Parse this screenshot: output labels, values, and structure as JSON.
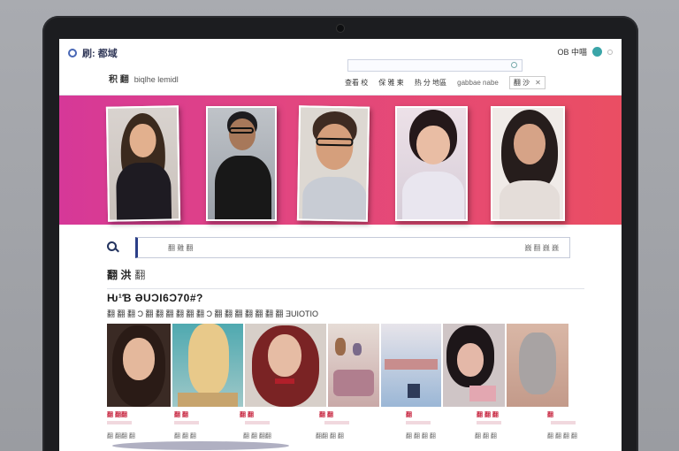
{
  "header": {
    "logo_text": "刷: 都域",
    "subtitle_main": "积 翻",
    "subtitle_extra": "biqlhe lemidl",
    "account_label": "OB 中喵",
    "search_placeholder": "",
    "nav": [
      "查看 校",
      "保 雅 柬",
      "热 分 地區",
      "gabbae nabe",
      "翻 沙",
      "✕"
    ]
  },
  "search": {
    "placeholder": "翻 雞 翻",
    "right_text": "巍 翻 巍 巍"
  },
  "section": {
    "title": "翻 洪",
    "title_extra": "翻",
    "heading": "Ƕ¹Ɓ ƏUƆI6Ɔ70#?",
    "description": "翻 翻 翻 Ɔ 翻 翻 翻 翻 翻 翻 Ɔ 翻 翻 翻 翻 翻 翻 翻 ƎUIOTIO"
  },
  "gallery": {
    "captions": [
      "翻 翻翻",
      "翻 翻",
      "翻 翻",
      "翻 翻",
      "翻",
      "翻 翻 翻",
      "翻"
    ],
    "sub_captions": [
      "翻 翻翻 翻",
      "翻 翻 翻",
      "翻 翻 翻翻",
      "翻翻 翻 翻",
      "翻 翻 翻 翻",
      "翻 翻 翻",
      "翻 翻 翻 翻"
    ]
  },
  "colors": {
    "hero_gradient_start": "#d63898",
    "hero_gradient_end": "#ea4e63",
    "accent": "#2b3f88",
    "caption_red": "#c7253f"
  }
}
